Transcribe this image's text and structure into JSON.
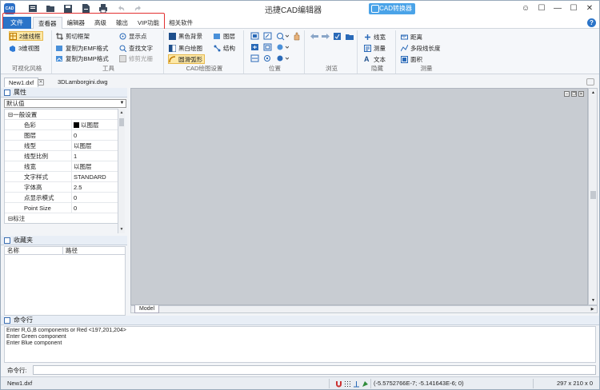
{
  "app": {
    "title": "迅捷CAD编辑器",
    "icon_label": "CAD",
    "converter_label": "CAD转换器",
    "colors": {
      "accent": "#2b74c8",
      "converter": "#4aa3e8",
      "highlight": "#e23030",
      "canvas": "#c8ccd2",
      "selected": "#fde8a6"
    }
  },
  "quick_access": [
    {
      "icon": "app-menu-icon"
    },
    {
      "icon": "open-folder-icon"
    },
    {
      "icon": "save-icon"
    },
    {
      "icon": "document-icon"
    },
    {
      "icon": "print-icon"
    },
    {
      "icon": "undo-icon"
    },
    {
      "icon": "redo-icon"
    }
  ],
  "window_controls": [
    "☺",
    "☐",
    "—",
    "☐",
    "✕"
  ],
  "menu": {
    "file": "文件",
    "tabs": [
      "查看器",
      "编辑器",
      "高级",
      "输出",
      "VIP功能",
      "相关软件"
    ],
    "active_tab": "查看器"
  },
  "ribbon": {
    "visual_style": {
      "title": "可视化风格",
      "items": [
        {
          "label": "2维线框",
          "icon": "wireframe-2d-icon",
          "selected": true
        },
        {
          "label": "3维视图",
          "icon": "view-3d-icon",
          "selected": false
        }
      ]
    },
    "tools": {
      "title": "工具",
      "items": [
        {
          "label": "剪切框架",
          "icon": "crop-frame-icon"
        },
        {
          "label": "复制为EMF格式",
          "icon": "copy-emf-icon"
        },
        {
          "label": "复制为BMP格式",
          "icon": "copy-bmp-icon"
        },
        {
          "label": "显示点",
          "icon": "show-points-icon"
        },
        {
          "label": "查找文字",
          "icon": "find-text-icon"
        },
        {
          "label": "修剪光栅",
          "icon": "trim-raster-icon",
          "disabled": true
        }
      ]
    },
    "cad_settings": {
      "title": "CAD绘图设置",
      "items": [
        {
          "label": "黑色背景",
          "icon": "black-background-icon"
        },
        {
          "label": "黑白绘图",
          "icon": "black-white-icon"
        },
        {
          "label": "圆滑弧形",
          "icon": "smooth-arc-icon",
          "selected": true
        },
        {
          "label": "图层",
          "icon": "layers-icon"
        },
        {
          "label": "结构",
          "icon": "structure-icon"
        }
      ]
    },
    "position": {
      "title": "位置"
    },
    "browse": {
      "title": "浏览"
    },
    "hide": {
      "title": "隐藏",
      "items": [
        {
          "label": "线宽",
          "icon": "line-width-icon"
        },
        {
          "label": "测量",
          "icon": "measure-icon"
        },
        {
          "label": "文本",
          "icon": "text-icon"
        }
      ]
    },
    "measure": {
      "title": "测量",
      "items": [
        {
          "label": "距离",
          "icon": "distance-icon"
        },
        {
          "label": "多段线长度",
          "icon": "polyline-length-icon"
        },
        {
          "label": "面积",
          "icon": "area-icon"
        }
      ]
    }
  },
  "doc_tabs": [
    {
      "label": "New1.dxf",
      "active": true
    },
    {
      "label": "3DLamborgini.dwg",
      "active": false
    }
  ],
  "properties": {
    "title": "属性",
    "selected": "默认值",
    "rows": [
      {
        "key": "一般设置",
        "value": "",
        "group": true,
        "expander": "⊟"
      },
      {
        "key": "色彩",
        "value": "以图层",
        "swatch": "#000000"
      },
      {
        "key": "图层",
        "value": "0"
      },
      {
        "key": "线型",
        "value": "以图层"
      },
      {
        "key": "线型比例",
        "value": "1"
      },
      {
        "key": "线宽",
        "value": "以图层"
      },
      {
        "key": "文字样式",
        "value": "STANDARD"
      },
      {
        "key": "字体高",
        "value": "2.5"
      },
      {
        "key": "点显示模式",
        "value": "0"
      },
      {
        "key": "Point Size",
        "value": "0"
      },
      {
        "key": "标注",
        "value": "",
        "group": true,
        "expander": "⊟"
      }
    ]
  },
  "favorites": {
    "title": "收藏夹",
    "columns": [
      "名称",
      "路径"
    ]
  },
  "canvas": {
    "model_tab": "Model"
  },
  "command": {
    "title": "命令行",
    "log": [
      "Enter R,G,B components or Red <197,201,204>",
      "Enter Green component",
      "Enter Blue component"
    ],
    "prompt_label": "命令行:",
    "input_value": ""
  },
  "status": {
    "file": "New1.dxf",
    "coords": "(-5.5752766E-7; -5.141643E-6; 0)",
    "paper_size": "297 x 210 x 0"
  }
}
